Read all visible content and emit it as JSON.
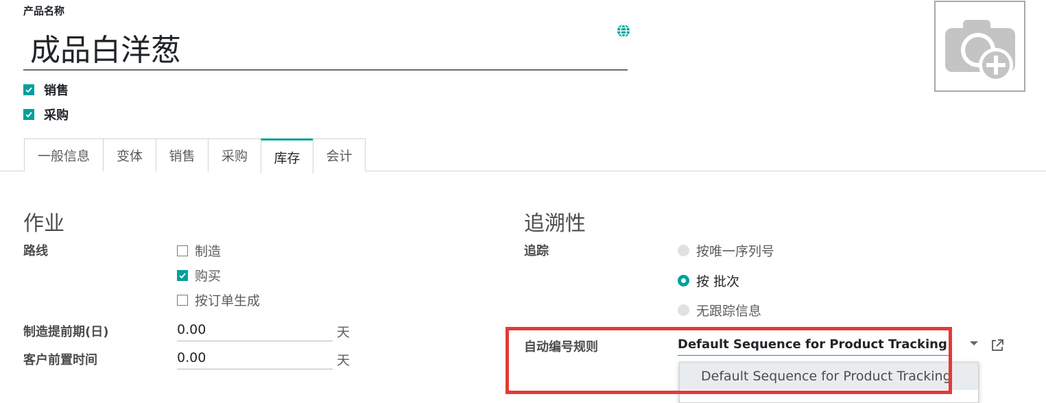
{
  "header": {
    "field_caption": "产品名称",
    "product_name": "成品白洋葱",
    "can_be_sold_label": "销售",
    "can_be_purchased_label": "采购"
  },
  "tabs": [
    {
      "label": "一般信息",
      "active": false
    },
    {
      "label": "变体",
      "active": false
    },
    {
      "label": "销售",
      "active": false
    },
    {
      "label": "采购",
      "active": false
    },
    {
      "label": "库存",
      "active": true
    },
    {
      "label": "会计",
      "active": false
    }
  ],
  "operations": {
    "title": "作业",
    "routes_label": "路线",
    "routes": [
      {
        "label": "制造",
        "checked": false
      },
      {
        "label": "购买",
        "checked": true
      },
      {
        "label": "按订单生成",
        "checked": false
      }
    ],
    "manufacture_lead_label": "制造提前期(日)",
    "manufacture_lead_value": "0.00",
    "manufacture_lead_unit": "天",
    "customer_lead_label": "客户前置时间",
    "customer_lead_value": "0.00",
    "customer_lead_unit": "天"
  },
  "traceability": {
    "title": "追溯性",
    "tracking_label": "追踪",
    "options": [
      {
        "label": "按唯一序列号",
        "selected": false
      },
      {
        "label": "按 批次",
        "selected": true
      },
      {
        "label": "无跟踪信息",
        "selected": false
      }
    ],
    "sequence_label": "自动编号规则",
    "sequence_value": "Default Sequence for Product Tracking",
    "dropdown_option": "Default Sequence for Product Tracking"
  },
  "colors": {
    "accent": "#00a09d",
    "highlight": "#e53935"
  },
  "icons": {
    "translate": "globe-icon",
    "image": "camera-plus-icon",
    "external": "external-link-icon"
  }
}
